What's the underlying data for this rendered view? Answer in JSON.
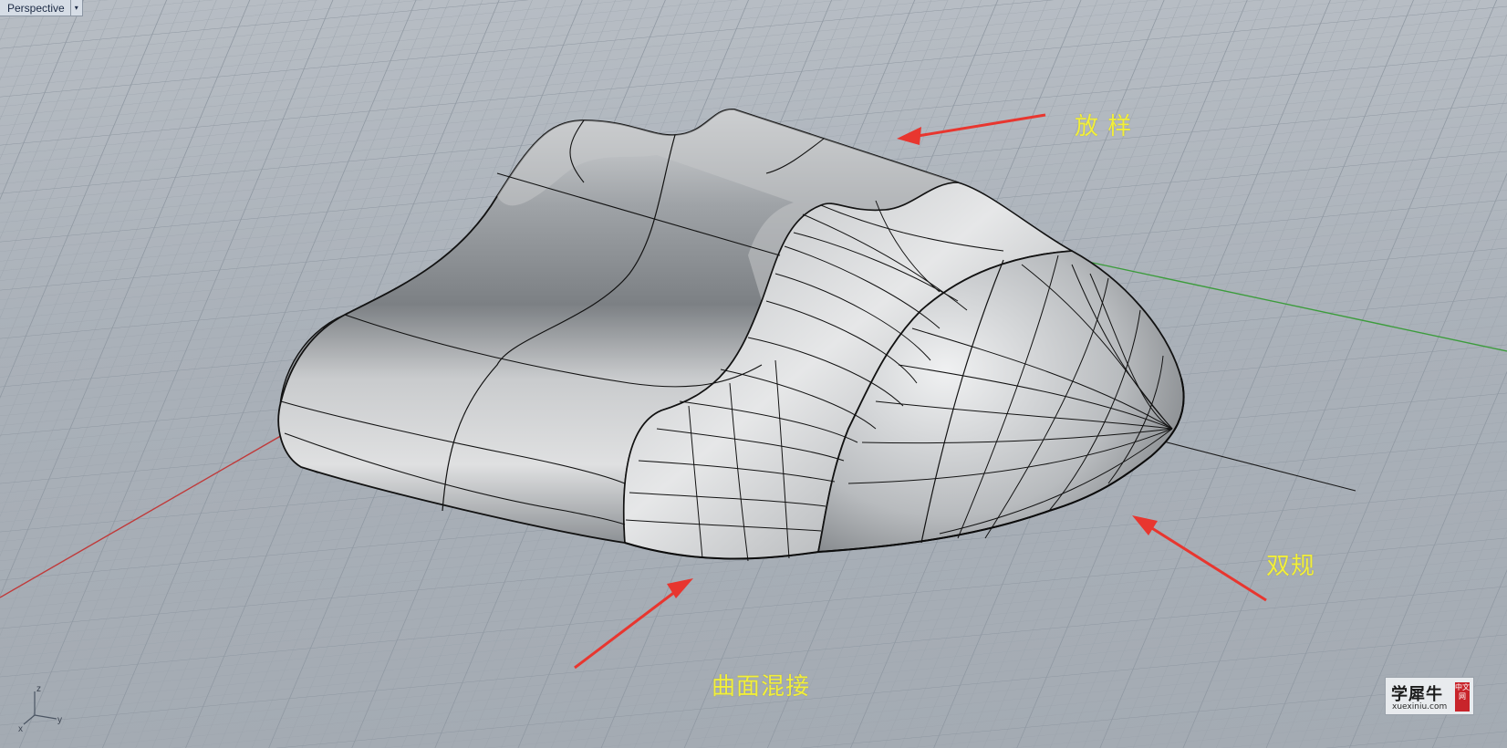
{
  "viewport": {
    "title": "Perspective",
    "dropdown_glyph": "▾"
  },
  "annotations": {
    "loft": "放 样",
    "blend_surface": "曲面混接",
    "sweep2": "双规"
  },
  "axis_triad": {
    "z": "z",
    "x": "x",
    "y": "y"
  },
  "watermark": {
    "brand": "学犀牛",
    "site": "xuexiniu.com",
    "seal": "中文网"
  },
  "colors": {
    "background": "#aab1b9",
    "grid_minor": "#9ba3ac",
    "grid_major": "#8e97a1",
    "x_axis": "#c03a3a",
    "y_axis": "#3c9c3c",
    "arrow": "#e8362f",
    "annotation_text": "#f2ef3a",
    "surface_edge": "#121212"
  },
  "icons": [
    "dropdown-arrow-icon",
    "axis-triad-icon",
    "red-arrow-icon"
  ]
}
